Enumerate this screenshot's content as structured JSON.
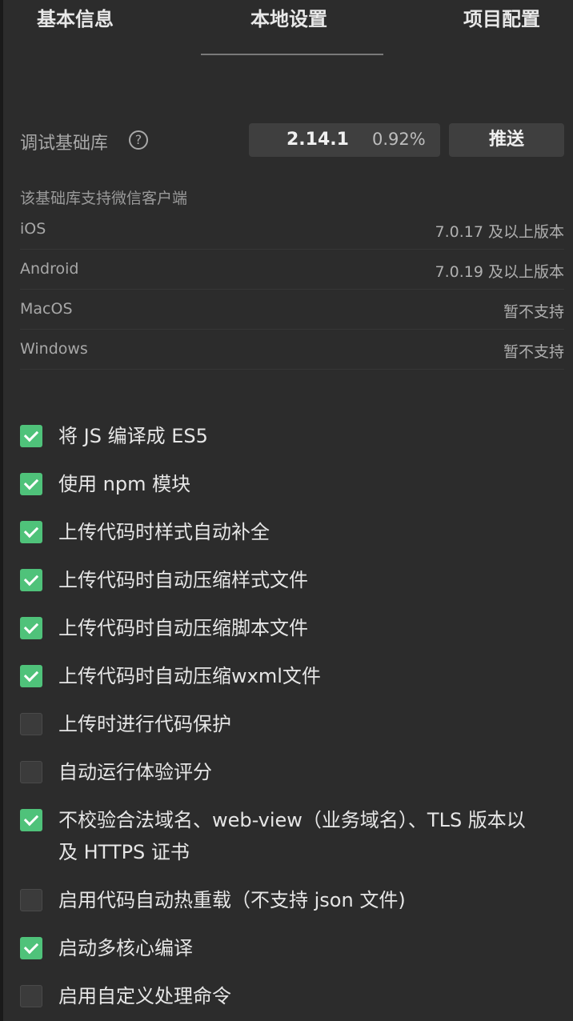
{
  "tabs": [
    {
      "label": "基本信息",
      "active": false
    },
    {
      "label": "本地设置",
      "active": true
    },
    {
      "label": "项目配置",
      "active": false
    }
  ],
  "debug_lib": {
    "label": "调试基础库",
    "help_icon": "question-circle-icon",
    "version": "2.14.1",
    "percent": "0.92%",
    "push_label": "推送"
  },
  "support": {
    "title": "该基础库支持微信客户端",
    "rows": [
      {
        "platform": "iOS",
        "value": "7.0.17 及以上版本"
      },
      {
        "platform": "Android",
        "value": "7.0.19 及以上版本"
      },
      {
        "platform": "MacOS",
        "value": "暂不支持"
      },
      {
        "platform": "Windows",
        "value": "暂不支持"
      }
    ]
  },
  "options": [
    {
      "label": "将 JS 编译成 ES5",
      "checked": true
    },
    {
      "label": "使用 npm 模块",
      "checked": true
    },
    {
      "label": "上传代码时样式自动补全",
      "checked": true
    },
    {
      "label": "上传代码时自动压缩样式文件",
      "checked": true
    },
    {
      "label": "上传代码时自动压缩脚本文件",
      "checked": true
    },
    {
      "label": "上传代码时自动压缩wxml文件",
      "checked": true
    },
    {
      "label": "上传时进行代码保护",
      "checked": false
    },
    {
      "label": "自动运行体验评分",
      "checked": false
    },
    {
      "label": "不校验合法域名、web-view（业务域名）、TLS 版本以及 HTTPS 证书",
      "checked": true
    },
    {
      "label": "启用代码自动热重载（不支持 json 文件)",
      "checked": false
    },
    {
      "label": "启动多核心编译",
      "checked": true
    },
    {
      "label": "启用自定义处理命令",
      "checked": false
    }
  ],
  "colors": {
    "checked": "#4fc27a",
    "background": "#2c2c2c"
  }
}
